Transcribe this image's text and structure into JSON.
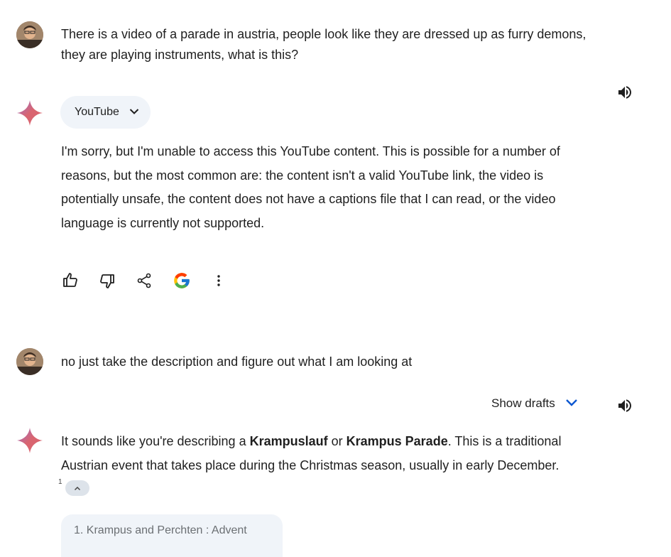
{
  "messages": {
    "user1": "There is a video of a parade in austria, people look like they are dressed up as furry demons, they are playing instruments, what is this?",
    "tool_chip_label": "YouTube",
    "response1": "I'm sorry, but I'm unable to access this YouTube content. This is possible for a number of reasons, but the most common are: the content isn't a valid YouTube link, the video is potentially unsafe, the content does not have a captions file that I can read, or the video language is currently not supported.",
    "user2": "no just take the description and figure out what I am looking at",
    "show_drafts_label": "Show drafts",
    "response2": {
      "part1": "It sounds like you're describing a ",
      "bold1": "Krampuslauf",
      "part2": " or ",
      "bold2": "Krampus Parade",
      "part3": ".  This is a traditional Austrian event that takes place during the Christmas season, usually in early December.",
      "citation_number": "1"
    },
    "source_item": "1.  Krampus and Perchten : Advent"
  },
  "icons": {
    "speaker": "volume-icon",
    "thumbs_up": "thumbs-up-icon",
    "thumbs_down": "thumbs-down-icon",
    "share": "share-icon",
    "google": "google-g-icon",
    "more": "more-vert-icon",
    "chevron": "chevron-down-icon",
    "sparkle": "gemini-sparkle-icon"
  },
  "colors": {
    "accent_blue": "#0b57d0",
    "chip_bg": "#f0f4f9",
    "text": "#1f1f1f"
  }
}
